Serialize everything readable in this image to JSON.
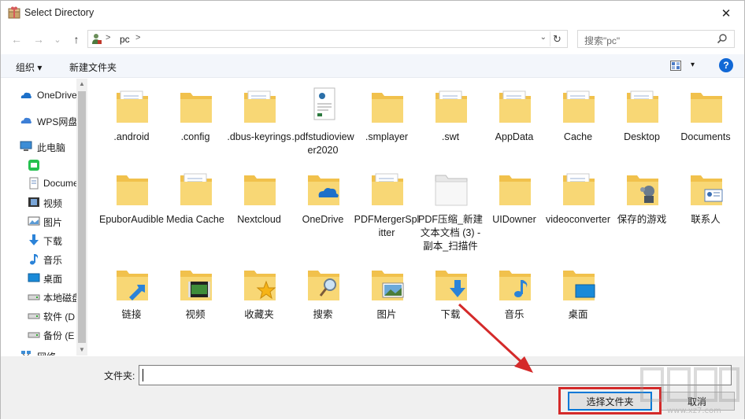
{
  "window": {
    "title": "Select Directory",
    "close_glyph": "✕"
  },
  "nav": {
    "back_glyph": "←",
    "forward_glyph": "→",
    "recent_glyph": "⌄",
    "up_glyph": "↑",
    "address": {
      "sep1": ">",
      "location": "pc",
      "sep2": ">",
      "dropdown_glyph": "⌄",
      "refresh_glyph": "↻"
    },
    "search": {
      "placeholder": "搜索\"pc\""
    }
  },
  "toolbar": {
    "organize_label": "组织 ▾",
    "new_folder_label": "新建文件夹",
    "view_drop": "▾",
    "help_label": "?"
  },
  "sidebar": {
    "items": [
      {
        "label": "OneDrive",
        "icon": "cloud-icon"
      },
      {
        "label": "WPS网盘",
        "icon": "wps-cloud-icon"
      },
      {
        "label": "此电脑",
        "icon": "computer-icon"
      },
      {
        "label": "",
        "icon": "app-icon-green"
      },
      {
        "label": "Documents",
        "icon": "documents-icon"
      },
      {
        "label": "视频",
        "icon": "video-icon"
      },
      {
        "label": "图片",
        "icon": "pictures-icon"
      },
      {
        "label": "下载",
        "icon": "download-icon"
      },
      {
        "label": "音乐",
        "icon": "music-icon"
      },
      {
        "label": "桌面",
        "icon": "desktop-icon"
      },
      {
        "label": "本地磁盘",
        "icon": "drive-icon"
      },
      {
        "label": "软件 (D",
        "icon": "drive-icon"
      },
      {
        "label": "备份 (E",
        "icon": "drive-icon"
      },
      {
        "label": "网络",
        "icon": "network-icon"
      }
    ]
  },
  "folders": [
    {
      "label": ".android",
      "type": "doc"
    },
    {
      "label": ".config",
      "type": "plain"
    },
    {
      "label": ".dbus-keyrings",
      "type": "doc"
    },
    {
      "label": ".pdfstudioviewer2020",
      "type": "pdfstudio"
    },
    {
      "label": ".smplayer",
      "type": "plain"
    },
    {
      "label": ".swt",
      "type": "doc"
    },
    {
      "label": "AppData",
      "type": "doc"
    },
    {
      "label": "Cache",
      "type": "doc"
    },
    {
      "label": "Desktop",
      "type": "doc"
    },
    {
      "label": "Documents",
      "type": "plain"
    },
    {
      "label": "EpuborAudible",
      "type": "plain"
    },
    {
      "label": "Media Cache",
      "type": "doc"
    },
    {
      "label": "Nextcloud",
      "type": "plain"
    },
    {
      "label": "OneDrive",
      "type": "onedrive"
    },
    {
      "label": "PDFMergerSplitter",
      "type": "doc"
    },
    {
      "label": "PDF压缩_新建文本文档 (3) - 副本_扫描件",
      "type": "white"
    },
    {
      "label": "UIDowner",
      "type": "plain"
    },
    {
      "label": "videoconverter",
      "type": "doc"
    },
    {
      "label": "保存的游戏",
      "type": "games"
    },
    {
      "label": "联系人",
      "type": "contacts"
    },
    {
      "label": "链接",
      "type": "links"
    },
    {
      "label": "视频",
      "type": "videos"
    },
    {
      "label": "收藏夹",
      "type": "favorites"
    },
    {
      "label": "搜索",
      "type": "search"
    },
    {
      "label": "图片",
      "type": "pictures"
    },
    {
      "label": "下载",
      "type": "downloads"
    },
    {
      "label": "音乐",
      "type": "music"
    },
    {
      "label": "桌面",
      "type": "desktop"
    }
  ],
  "footer": {
    "folder_label": "文件夹:",
    "folder_value": "",
    "choose_button": "选择文件夹",
    "cancel_button": "取消"
  },
  "watermark": {
    "text": "www.xz7.com"
  },
  "colors": {
    "accent": "#0078d7",
    "highlight": "#d42a2a",
    "folder": "#f5cd5e"
  }
}
